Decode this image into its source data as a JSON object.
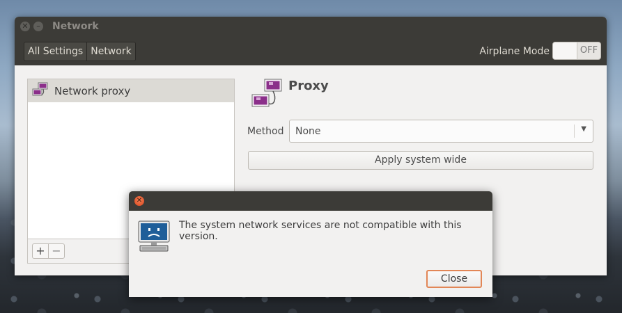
{
  "window": {
    "title": "Network",
    "breadcrumbs": [
      "All Settings",
      "Network"
    ],
    "airplane_mode_label": "Airplane Mode",
    "airplane_mode_state": "OFF"
  },
  "list": {
    "items": [
      {
        "label": "Network proxy",
        "icon": "network-proxy-icon"
      }
    ],
    "add_label": "+",
    "remove_label": "−"
  },
  "proxy": {
    "title": "Proxy",
    "method_label": "Method",
    "method_value": "None",
    "apply_label": "Apply system wide"
  },
  "dialog": {
    "message": "The system network services are not compatible with this version.",
    "close_label": "Close",
    "icon": "network-error-computer-icon"
  },
  "colors": {
    "titlebar": "#3c3b37",
    "window_bg": "#f2f1f0",
    "accent": "#e28656"
  }
}
